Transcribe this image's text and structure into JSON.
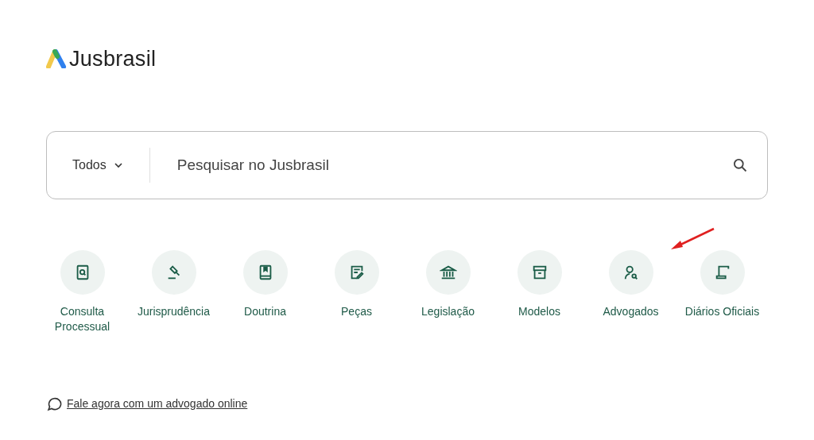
{
  "logo": {
    "text": "Jusbrasil"
  },
  "search": {
    "category": "Todos",
    "placeholder": "Pesquisar no Jusbrasil"
  },
  "shortcuts": [
    {
      "label": "Consulta Processual"
    },
    {
      "label": "Jurisprudência"
    },
    {
      "label": "Doutrina"
    },
    {
      "label": "Peças"
    },
    {
      "label": "Legislação"
    },
    {
      "label": "Modelos"
    },
    {
      "label": "Advogados"
    },
    {
      "label": "Diários Oficiais"
    }
  ],
  "chat_link": {
    "text": "Fale agora com um advogado online"
  }
}
